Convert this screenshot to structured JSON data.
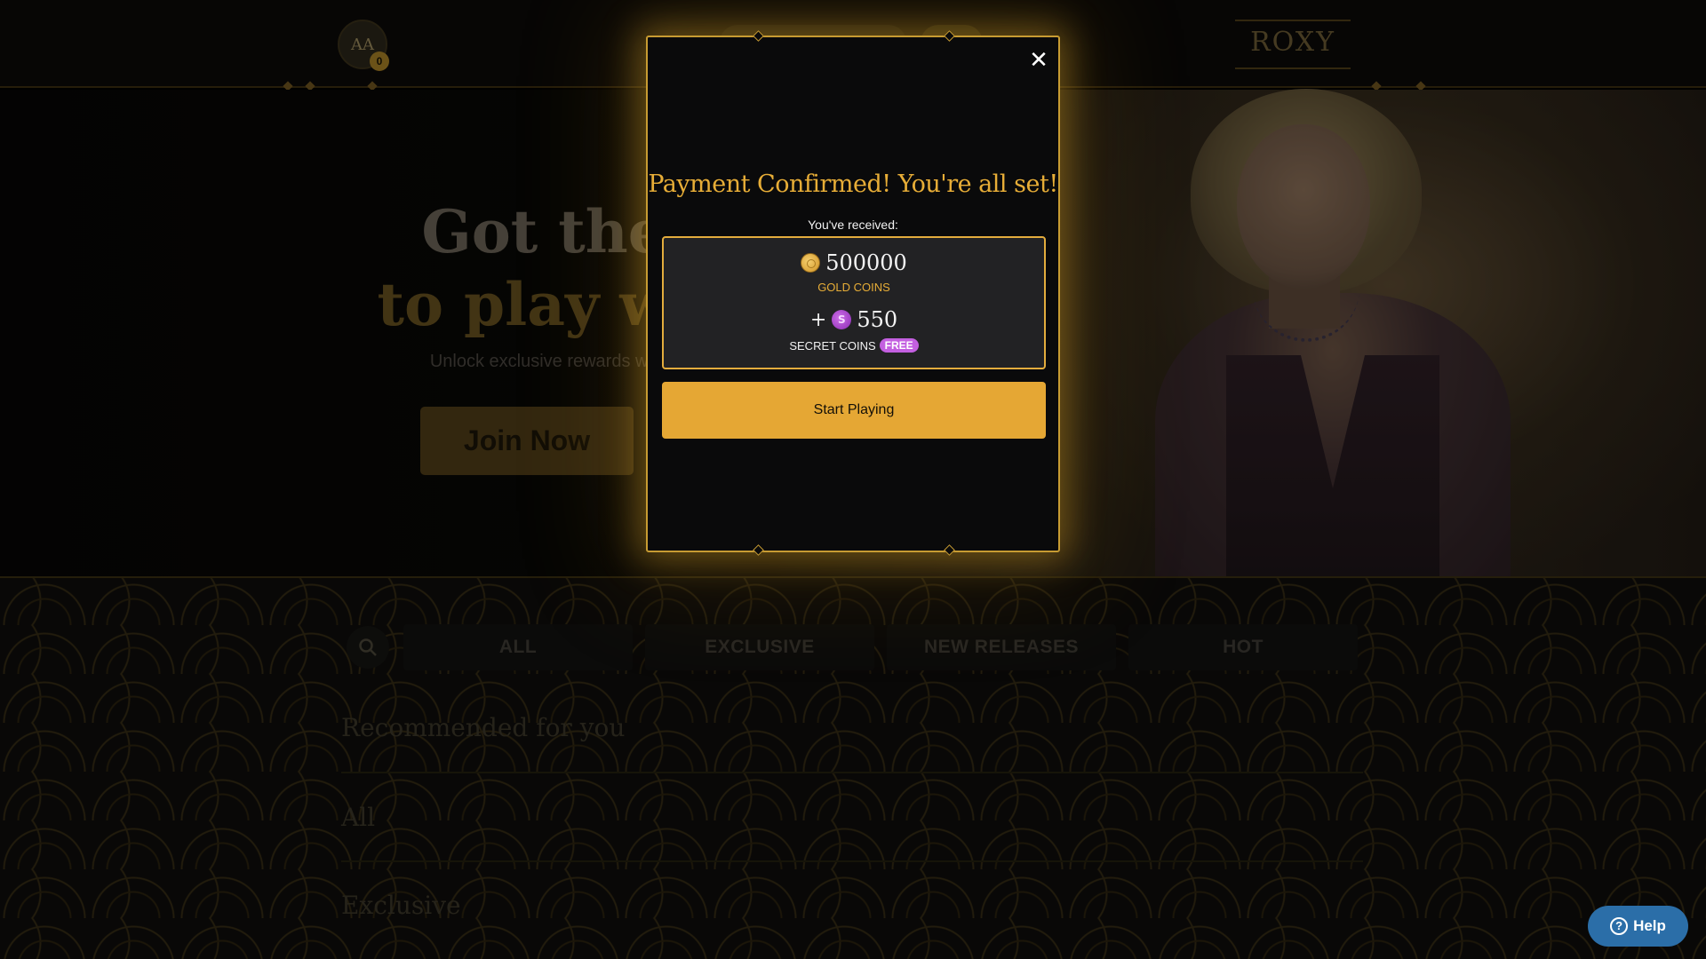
{
  "header": {
    "avatar_initials": "AA",
    "notification_count": "0",
    "logo_text": "ROXY"
  },
  "hero": {
    "title_line1": "Got the mo",
    "title_line2": "to play with R",
    "subtitle": "Unlock exclusive rewards with your first step",
    "join_button": "Join Now"
  },
  "filters": {
    "tabs": [
      "ALL",
      "EXCLUSIVE",
      "NEW RELEASES",
      "HOT"
    ]
  },
  "sections": {
    "recommended": "Recommended for you",
    "all": "All",
    "exclusive": "Exclusive"
  },
  "modal": {
    "close_glyph": "✕",
    "title": "Payment Confirmed! You're all set!",
    "received_label": "You've received:",
    "gold_amount": "500000",
    "gold_label": "GOLD COINS",
    "plus": "+",
    "secret_amount": "550",
    "secret_label": "SECRET COINS",
    "free_badge": "FREE",
    "start_button": "Start Playing"
  },
  "help": {
    "label": "Help",
    "icon_glyph": "?"
  },
  "colors": {
    "accent_gold": "#e5a734",
    "modal_border": "#c79b32",
    "secret_purple": "#c35fe0",
    "help_blue": "#2b6ea8"
  },
  "icons": {
    "close": "close-icon",
    "gold_coin": "gold-coin-icon",
    "secret_coin": "secret-coin-icon",
    "search": "search-icon",
    "help": "help-icon"
  }
}
